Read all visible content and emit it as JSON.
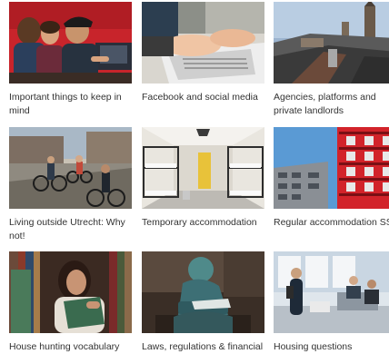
{
  "cards": [
    {
      "label": "Important things to keep in mind",
      "image": "students-at-laptop-photo",
      "accent": "#c8242b"
    },
    {
      "label": "Facebook and social media",
      "image": "typing-on-laptop-photo",
      "accent": "#d9d6cf"
    },
    {
      "label": "Agencies, platforms and private landlords",
      "image": "utrecht-rooftops-photo",
      "accent": "#6f8fb3"
    },
    {
      "label": "Living outside Utrecht: Why not!",
      "image": "cyclists-street-photo",
      "accent": "#7a8a9a"
    },
    {
      "label": "Temporary accommodation",
      "image": "bunk-bed-dorm-photo",
      "accent": "#e8c23a"
    },
    {
      "label": "Regular accommodation SSH",
      "image": "red-apartment-building-photo",
      "accent": "#d2232a"
    },
    {
      "label": "House hunting vocabulary",
      "image": "woman-reading-library-photo",
      "accent": "#3a6b4f"
    },
    {
      "label": "Laws, regulations & financial",
      "image": "statue-reading-photo",
      "accent": "#3d6f75"
    },
    {
      "label": "Housing questions",
      "image": "office-people-photo",
      "accent": "#c9d6e2"
    }
  ]
}
